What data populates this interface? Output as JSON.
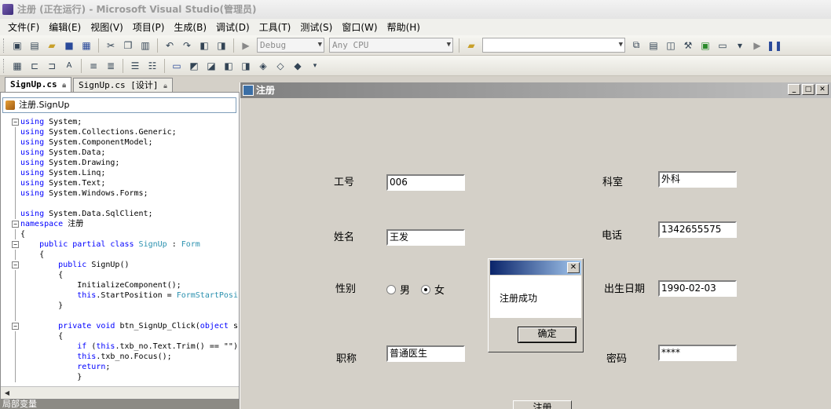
{
  "window": {
    "title": "注册 (正在运行) - Microsoft Visual Studio(管理员)"
  },
  "menu": [
    "文件(F)",
    "编辑(E)",
    "视图(V)",
    "项目(P)",
    "生成(B)",
    "调试(D)",
    "工具(T)",
    "测试(S)",
    "窗口(W)",
    "帮助(H)"
  ],
  "toolbar": {
    "config": "Debug",
    "platform": "Any CPU",
    "find": ""
  },
  "tabs": [
    {
      "label": "SignUp.cs",
      "active": true
    },
    {
      "label": "SignUp.cs [设计]",
      "active": false
    }
  ],
  "editor": {
    "nav": "注册.SignUp",
    "lines": [
      [
        {
          "t": "using",
          "c": "kw"
        },
        {
          "t": " System;"
        }
      ],
      [
        {
          "t": "using",
          "c": "kw"
        },
        {
          "t": " System.Collections.Generic;"
        }
      ],
      [
        {
          "t": "using",
          "c": "kw"
        },
        {
          "t": " System.ComponentModel;"
        }
      ],
      [
        {
          "t": "using",
          "c": "kw"
        },
        {
          "t": " System.Data;"
        }
      ],
      [
        {
          "t": "using",
          "c": "kw"
        },
        {
          "t": " System.Drawing;"
        }
      ],
      [
        {
          "t": "using",
          "c": "kw"
        },
        {
          "t": " System.Linq;"
        }
      ],
      [
        {
          "t": "using",
          "c": "kw"
        },
        {
          "t": " System.Text;"
        }
      ],
      [
        {
          "t": "using",
          "c": "kw"
        },
        {
          "t": " System.Windows.Forms;"
        }
      ],
      [],
      [
        {
          "t": "using",
          "c": "kw"
        },
        {
          "t": " System.Data.SqlClient;"
        }
      ],
      [
        {
          "t": "namespace",
          "c": "kw"
        },
        {
          "t": " 注册"
        }
      ],
      [
        {
          "t": "{"
        }
      ],
      [
        {
          "t": "    "
        },
        {
          "t": "public partial class",
          "c": "kw"
        },
        {
          "t": " "
        },
        {
          "t": "SignUp",
          "c": "ty"
        },
        {
          "t": " : "
        },
        {
          "t": "Form",
          "c": "ty"
        }
      ],
      [
        {
          "t": "    {"
        }
      ],
      [
        {
          "t": "        "
        },
        {
          "t": "public",
          "c": "kw"
        },
        {
          "t": " SignUp()"
        }
      ],
      [
        {
          "t": "        {"
        }
      ],
      [
        {
          "t": "            InitializeComponent();"
        }
      ],
      [
        {
          "t": "            "
        },
        {
          "t": "this",
          "c": "kw"
        },
        {
          "t": ".StartPosition = "
        },
        {
          "t": "FormStartPosi",
          "c": "ty"
        }
      ],
      [
        {
          "t": "        }"
        }
      ],
      [],
      [
        {
          "t": "        "
        },
        {
          "t": "private void",
          "c": "kw"
        },
        {
          "t": " btn_SignUp_Click("
        },
        {
          "t": "object",
          "c": "kw"
        },
        {
          "t": " s"
        }
      ],
      [
        {
          "t": "        {"
        }
      ],
      [
        {
          "t": "            "
        },
        {
          "t": "if",
          "c": "kw"
        },
        {
          "t": " ("
        },
        {
          "t": "this",
          "c": "kw"
        },
        {
          "t": ".txb_no.Text.Trim() == \"\")"
        }
      ],
      [
        {
          "t": "            "
        },
        {
          "t": "this",
          "c": "kw"
        },
        {
          "t": ".txb_no.Focus();"
        }
      ],
      [
        {
          "t": "            "
        },
        {
          "t": "return",
          "c": "kw"
        },
        {
          "t": ";"
        }
      ],
      [
        {
          "t": "            }"
        }
      ]
    ]
  },
  "locals_label": "局部变量",
  "form": {
    "title": "注册",
    "labels": {
      "no": "工号",
      "name": "姓名",
      "gender": "性别",
      "title": "职称",
      "dept": "科室",
      "phone": "电话",
      "birth": "出生日期",
      "password": "密码"
    },
    "values": {
      "no": "006",
      "name": "王发",
      "title": "普通医生",
      "dept": "外科",
      "phone": "1342655575",
      "birth": "1990-02-03",
      "password": "****"
    },
    "gender_options": {
      "male": "男",
      "female": "女"
    },
    "gender_selected": "female",
    "submit": "注册"
  },
  "messagebox": {
    "text": "注册成功",
    "ok": "确定"
  }
}
